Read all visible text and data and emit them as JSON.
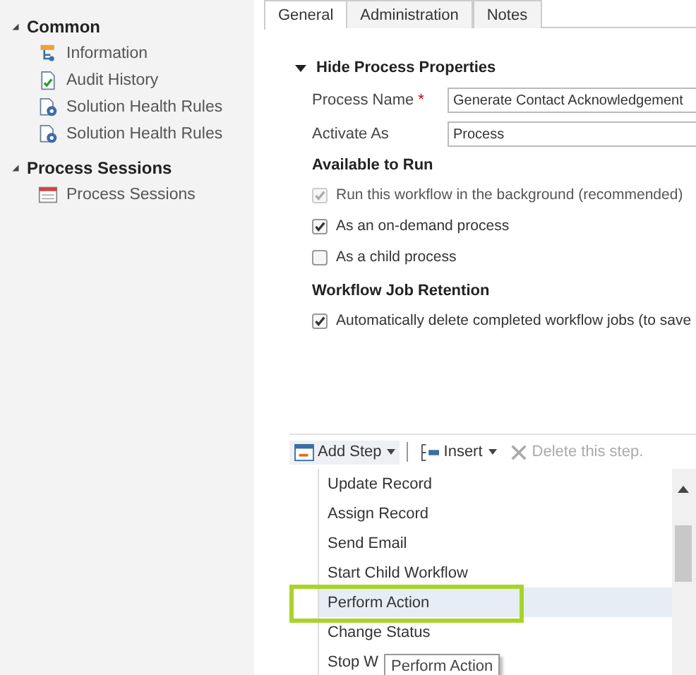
{
  "sidebar": {
    "sections": [
      {
        "title": "Common",
        "expanded": true,
        "items": [
          {
            "label": "Information",
            "kind": "info"
          },
          {
            "label": "Audit History",
            "kind": "audit"
          },
          {
            "label": "Solution Health Rules",
            "kind": "health"
          },
          {
            "label": "Solution Health Rules",
            "kind": "health"
          }
        ]
      },
      {
        "title": "Process Sessions",
        "expanded": true,
        "items": [
          {
            "label": "Process Sessions",
            "kind": "sessions"
          }
        ]
      }
    ]
  },
  "tabs": [
    {
      "label": "General",
      "selected": true
    },
    {
      "label": "Administration",
      "selected": false
    },
    {
      "label": "Notes",
      "selected": false
    }
  ],
  "section": {
    "title": "Hide Process Properties",
    "expanded": true
  },
  "fields": [
    {
      "label": "Process Name",
      "required_mark": "*",
      "value": "Generate Contact Acknowledgement"
    },
    {
      "label": "Activate As",
      "value": "Process"
    }
  ],
  "available_to_run": {
    "title": "Available to Run",
    "options": [
      {
        "label": "Run this workflow in the background (recommended)",
        "checked": true,
        "disabled": true
      },
      {
        "label": "As an on-demand process",
        "checked": true,
        "disabled": false
      },
      {
        "label": "As a child process",
        "checked": false,
        "disabled": false
      }
    ]
  },
  "retention": {
    "title": "Workflow Job Retention",
    "options": [
      {
        "label": "Automatically delete completed workflow jobs (to save",
        "checked": true,
        "disabled": false
      }
    ]
  },
  "toolbar": [
    {
      "label": "Add Step",
      "kind": "add",
      "dropdown": true,
      "disabled": false
    },
    {
      "label": "Insert",
      "kind": "insert",
      "dropdown": true,
      "disabled": false
    },
    {
      "label": "Delete this step.",
      "kind": "delete",
      "dropdown": false,
      "disabled": true
    }
  ],
  "menu": {
    "items": [
      {
        "label": "Update Record",
        "selected": false
      },
      {
        "label": "Assign Record",
        "selected": false
      },
      {
        "label": "Send Email",
        "selected": false
      },
      {
        "label": "Start Child Workflow",
        "selected": false
      },
      {
        "label": "Perform Action",
        "selected": true
      },
      {
        "label": "Change Status",
        "selected": false
      },
      {
        "label": "Stop W",
        "selected": false
      }
    ],
    "tooltip": "Perform Action"
  }
}
